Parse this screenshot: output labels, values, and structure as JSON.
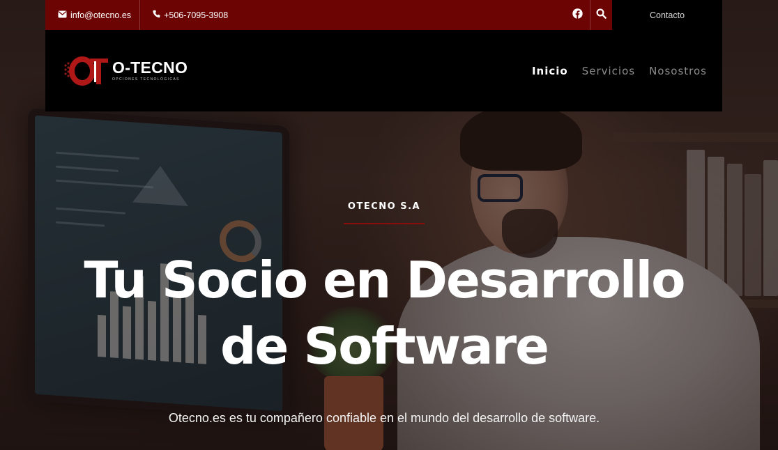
{
  "topbar": {
    "email": "info@otecno.es",
    "phone": "+506-7095-3908",
    "contact_label": "Contacto",
    "accent_color": "#6d0404"
  },
  "logo": {
    "name": "O-TECNO",
    "tagline": "OPCIONES TECNOLÓGICAS"
  },
  "nav": {
    "items": [
      {
        "label": "Inicio",
        "active": true
      },
      {
        "label": "Servicios",
        "active": false
      },
      {
        "label": "Nosostros",
        "active": false
      }
    ]
  },
  "hero": {
    "eyebrow": "OTECNO S.A",
    "headline": "Tu Socio en Desarrollo de Software",
    "subtitle": "Otecno.es es tu compañero confiable en el mundo del desarrollo de software.",
    "accent_line_color": "#8a0d0d"
  },
  "icons": {
    "email": "envelope-icon",
    "phone": "phone-icon",
    "facebook": "facebook-icon",
    "search": "search-icon"
  }
}
